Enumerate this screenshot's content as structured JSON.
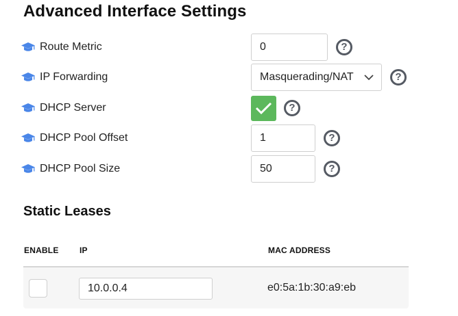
{
  "title": "Advanced Interface Settings",
  "accent_icon_color": "#4a86e8",
  "check_color": "#5cb85c",
  "settings": [
    {
      "label": "Route Metric",
      "icon": "graduation-cap-icon",
      "type": "text",
      "value": "0"
    },
    {
      "label": "IP Forwarding",
      "icon": "graduation-cap-icon",
      "type": "select",
      "value": "Masquerading/NAT"
    },
    {
      "label": "DHCP Server",
      "icon": "graduation-cap-icon",
      "type": "checkbox",
      "checked": true
    },
    {
      "label": "DHCP Pool Offset",
      "icon": "graduation-cap-icon",
      "type": "text",
      "value": "1"
    },
    {
      "label": "DHCP Pool Size",
      "icon": "graduation-cap-icon",
      "type": "text",
      "value": "50"
    }
  ],
  "help_glyph": "?",
  "static_leases": {
    "title": "Static Leases",
    "columns": [
      "ENABLE",
      "IP",
      "MAC ADDRESS"
    ],
    "rows": [
      {
        "enabled": false,
        "ip": "10.0.0.4",
        "mac": "e0:5a:1b:30:a9:eb"
      }
    ]
  }
}
